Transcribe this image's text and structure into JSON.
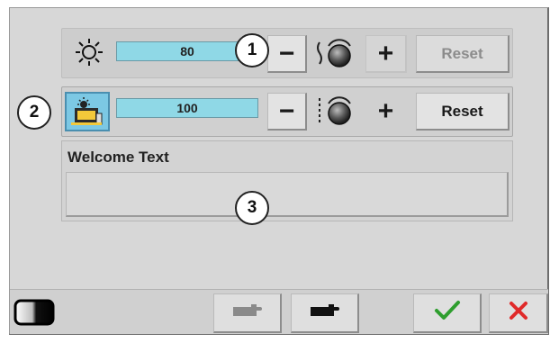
{
  "rows": [
    {
      "name": "brightness",
      "icon": "sun-icon",
      "value": "80",
      "level_percent": 80,
      "minus_label": "−",
      "plus_label": "+",
      "reset_label": "Reset",
      "reset_enabled": false
    },
    {
      "name": "scene",
      "icon": "scene-image-icon",
      "value": "100",
      "level_percent": 100,
      "minus_label": "−",
      "plus_label": "+",
      "reset_label": "Reset",
      "reset_enabled": true
    }
  ],
  "welcome": {
    "title": "Welcome Text",
    "text": ""
  },
  "callouts": [
    "1",
    "2",
    "3"
  ],
  "footer": {
    "icons": [
      "contrast-icon",
      "hand-pointer-light-icon",
      "hand-pointer-dark-icon",
      "checkmark-icon",
      "cancel-x-icon"
    ]
  },
  "colors": {
    "accent_bar": "#8fd8e6",
    "confirm": "#2e9e2e",
    "cancel": "#e02a2a"
  }
}
